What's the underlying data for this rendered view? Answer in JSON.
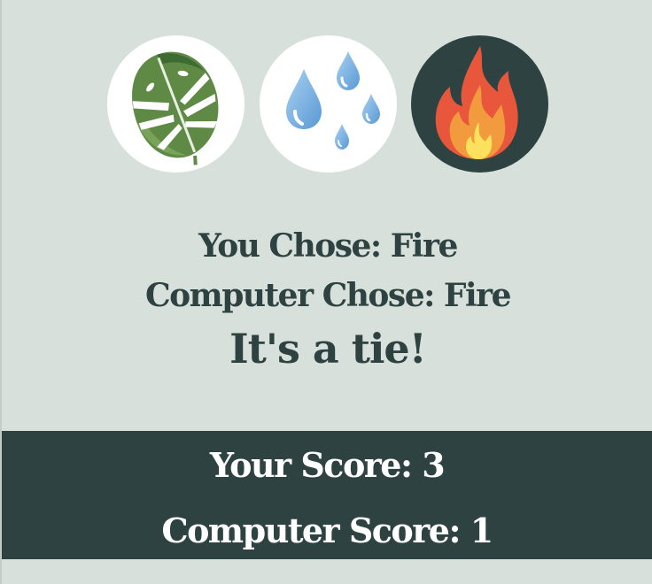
{
  "choices": [
    {
      "id": "grass",
      "icon": "monstera-leaf-icon",
      "color": "#5e8a45"
    },
    {
      "id": "water",
      "icon": "water-drops-icon",
      "color": "#7fb6e6"
    },
    {
      "id": "fire",
      "icon": "fire-icon",
      "color": "#e8573c"
    }
  ],
  "result": {
    "you_chose": "You Chose: Fire",
    "computer_chose": "Computer Chose: Fire",
    "outcome": "It's a tie!"
  },
  "score": {
    "user_label": "Your Score: 3",
    "computer_label": "Computer Score: 1"
  },
  "colors": {
    "background": "#d8e0dc",
    "accent_dark": "#2e4341",
    "text_light": "#ffffff"
  }
}
